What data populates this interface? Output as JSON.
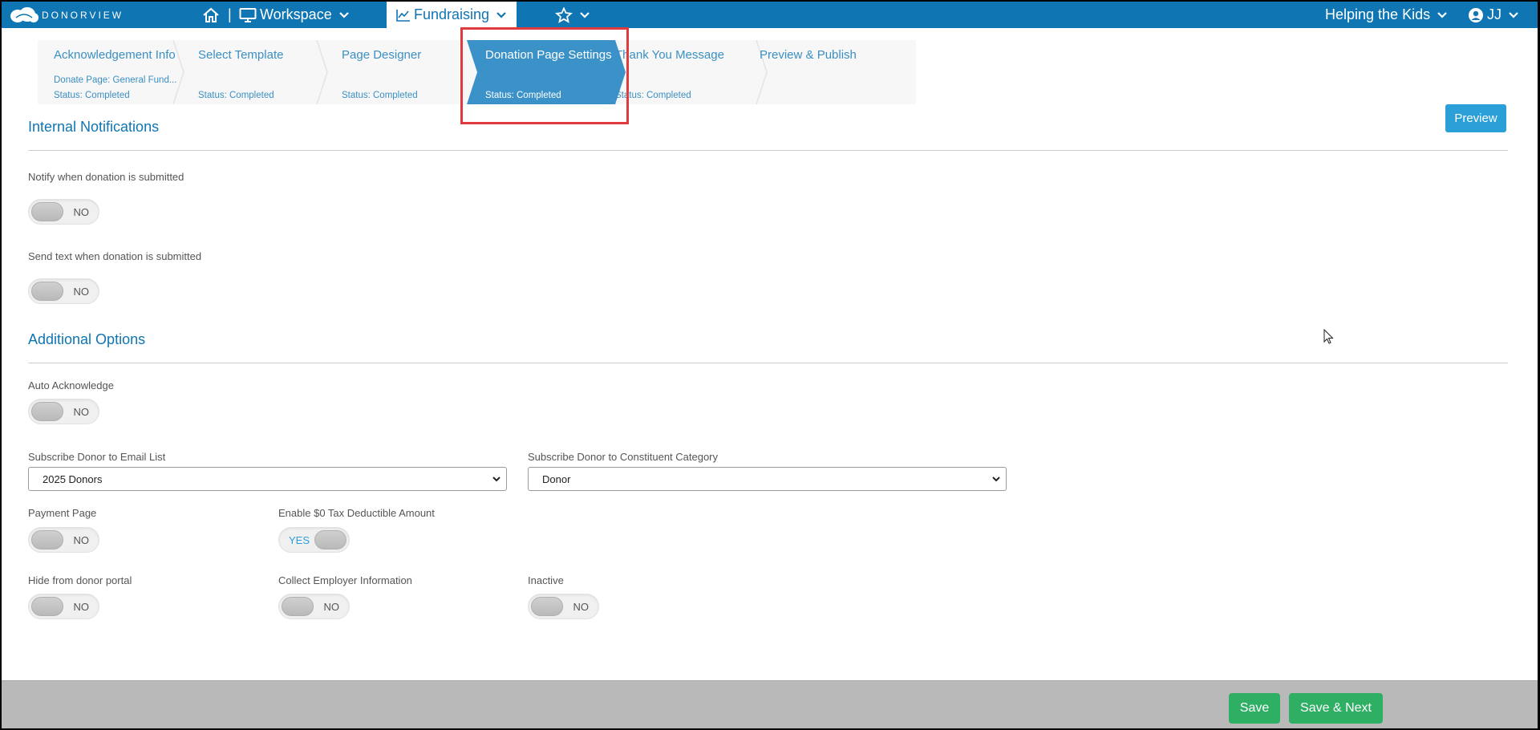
{
  "nav": {
    "logo_text": "DONORVIEW",
    "separator": "|",
    "workspace": "Workspace",
    "fundraising": "Fundraising",
    "org": "Helping the Kids",
    "user": "JJ"
  },
  "steps": [
    {
      "title": "Acknowledgement Info",
      "subtitle": "Donate Page: General Fund...",
      "status": "Status: Completed"
    },
    {
      "title": "Select Template",
      "status": "Status: Completed"
    },
    {
      "title": "Page Designer",
      "status": "Status: Completed"
    },
    {
      "title": "Donation Page Settings",
      "status": "Status: Completed",
      "active": true
    },
    {
      "title": "Thank You Message",
      "status": "Status: Completed"
    },
    {
      "title": "Preview & Publish"
    }
  ],
  "preview_button": "Preview",
  "sections": {
    "internal": "Internal Notifications",
    "additional": "Additional Options"
  },
  "fields": {
    "notify_submitted": {
      "label": "Notify when donation is submitted",
      "value": "NO"
    },
    "text_submitted": {
      "label": "Send text when donation is submitted",
      "value": "NO"
    },
    "auto_ack": {
      "label": "Auto Acknowledge",
      "value": "NO"
    },
    "email_list": {
      "label": "Subscribe Donor to Email List",
      "value": "2025 Donors"
    },
    "constituent_cat": {
      "label": "Subscribe Donor to Constituent Category",
      "value": "Donor"
    },
    "payment_page": {
      "label": "Payment Page",
      "value": "NO"
    },
    "zero_tax": {
      "label": "Enable $0 Tax Deductible Amount",
      "value": "YES"
    },
    "hide_portal": {
      "label": "Hide from donor portal",
      "value": "NO"
    },
    "employer_info": {
      "label": "Collect Employer Information",
      "value": "NO"
    },
    "inactive": {
      "label": "Inactive",
      "value": "NO"
    }
  },
  "footer": {
    "save": "Save",
    "save_next": "Save & Next"
  },
  "colors": {
    "brand_blue": "#0f75b3",
    "active_step": "#3b92c8",
    "save_green": "#2eaf64",
    "highlight": "#e0393e"
  }
}
